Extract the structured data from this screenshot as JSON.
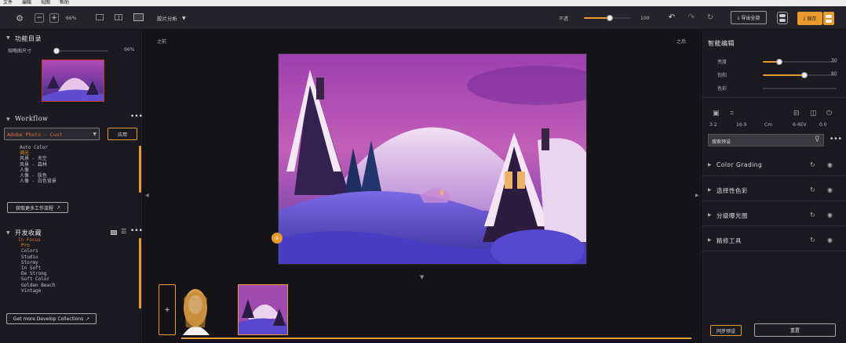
{
  "menubar": {
    "items": [
      "文件",
      "编辑",
      "视图",
      "帮助"
    ]
  },
  "toolbar": {
    "zoom_out": "−",
    "zoom_in": "+",
    "zoom_level": "66%",
    "view_mode": "胶片分析",
    "opacity_label": "不透",
    "opacity_value": "100",
    "opacity_fraction": 0.55,
    "export_label": "导出全部",
    "save_label": "保存"
  },
  "left": {
    "section1_title": "功能目录",
    "thumb_slider_label": "缩略图尺寸",
    "thumb_slider_value": "66%",
    "thumb_fraction": 0.0,
    "workflow_title": "Workflow",
    "workflow_preset": "Adobe Photo - Cust",
    "workflow_button": "应用",
    "workflow_items": [
      "Auto Color",
      "调光",
      "风景 - 天空",
      "风景 - 森林",
      "人像",
      "人像 - 肤色",
      "人像 - 白色背景"
    ],
    "workflow_active_index": 1,
    "workflow_footer": "获取更多工作流程",
    "collections_title": "开发收藏",
    "collections_items": [
      "In Focus",
      "Pro",
      "Colors",
      "Studio",
      "Stormy",
      "In Soft",
      "De Strong",
      "Soft Color",
      "Golden Beach",
      "Vintage"
    ],
    "collections_footer": "Get more Develop Collections"
  },
  "center": {
    "before_label": "之前",
    "after_label": "之后",
    "add_label": "+",
    "split_badge": "II"
  },
  "right": {
    "title": "智能编辑",
    "sliders": [
      {
        "label": "亮度",
        "value": "30",
        "fraction": 0.22
      },
      {
        "label": "饱和",
        "value": "80",
        "fraction": 0.56
      },
      {
        "label": "色彩",
        "value": "",
        "fraction": 0.0
      }
    ],
    "info": [
      "3:2",
      "16:9",
      "Cm",
      "6:4EV",
      "0.0"
    ],
    "filter_placeholder": "搜索预设",
    "groups": [
      "Color Grading",
      "选择性色彩",
      "分级曝光图",
      "精修工具"
    ],
    "reset_label": "重置",
    "apply_label": "同步预设"
  },
  "colors": {
    "accent": "#e89a2c",
    "bg": "#1b1a20"
  }
}
